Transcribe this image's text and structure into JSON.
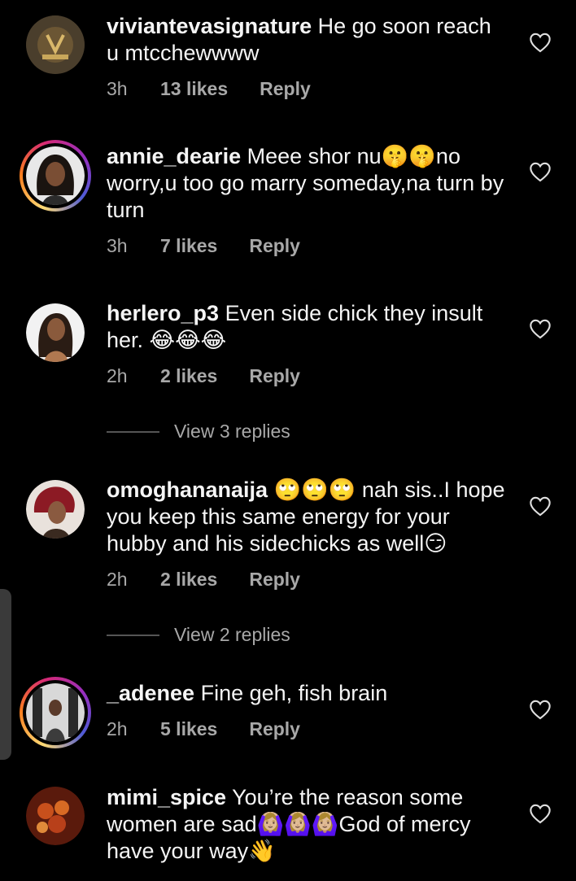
{
  "comments": [
    {
      "user": "viviantevasignature",
      "text": " He go soon reach u mtcchewwww",
      "time": "3h",
      "likes": "13 likes",
      "reply": "Reply"
    },
    {
      "user": "annie_dearie",
      "text": " Meee shor nu🤫🤫no worry,u too go marry someday,na turn by turn",
      "time": "3h",
      "likes": "7 likes",
      "reply": "Reply"
    },
    {
      "user": "herlero_p3",
      "text": " Even side chick they insult her. 😂😂😂",
      "time": "2h",
      "likes": "2 likes",
      "reply": "Reply"
    },
    {
      "user": "omoghananaija",
      "text": " 🙄🙄🙄 nah sis..I hope you keep this same energy for your hubby and his sidechicks as well😏",
      "time": "2h",
      "likes": "2 likes",
      "reply": "Reply"
    },
    {
      "user": "_adenee",
      "text": " Fine geh, fish brain",
      "time": "2h",
      "likes": "5 likes",
      "reply": "Reply"
    },
    {
      "user": "mimi_spice",
      "text": " You’re the reason some women are sad🙆🏼‍♀️🙆🏼‍♀️🙆🏼‍♀️God of mercy have your way👋",
      "time": "",
      "likes": "",
      "reply": ""
    }
  ],
  "view_replies": [
    {
      "label": "View 3 replies"
    },
    {
      "label": "View 2 replies"
    }
  ],
  "colors": {
    "background": "#000000",
    "text": "#f5f5f5",
    "secondary": "#a8a8a8"
  },
  "icons": {
    "like": "heart-outline-icon"
  }
}
